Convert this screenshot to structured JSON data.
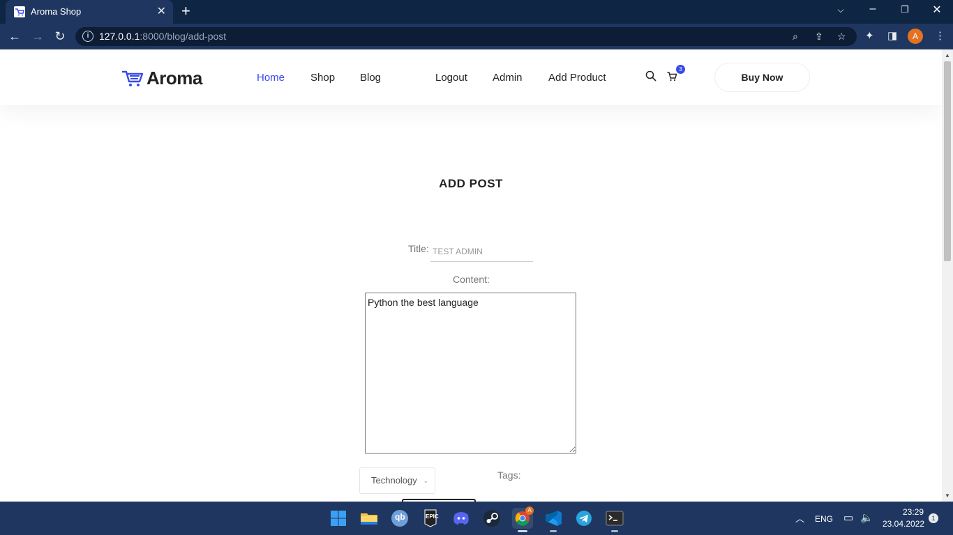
{
  "browser": {
    "tab_title": "Aroma Shop",
    "url_host": "127.0.0.1",
    "url_path": ":8000/blog/add-post",
    "profile_initial": "A"
  },
  "header": {
    "logo_text": "Aroma",
    "nav": [
      "Home",
      "Shop",
      "Blog",
      "Logout",
      "Admin",
      "Add Product"
    ],
    "active_nav": "Home",
    "cart_count": "3",
    "buy_now": "Buy Now"
  },
  "form": {
    "heading": "ADD POST",
    "title_label": "Title:",
    "title_value": "TEST ADMIN",
    "content_label": "Content:",
    "content_value": "Python the best language",
    "category_selected": "Technology",
    "tags_label": "Tags:"
  },
  "taskbar": {
    "language": "ENG",
    "time": "23:29",
    "date": "23.04.2022",
    "notifications": "1",
    "chrome_badge": "A",
    "epic_label": "EPIC",
    "qbit_label": "qb"
  },
  "colors": {
    "accent": "#384aeb",
    "chrome_dark": "#0f2544",
    "chrome_mid": "#1f3760"
  }
}
